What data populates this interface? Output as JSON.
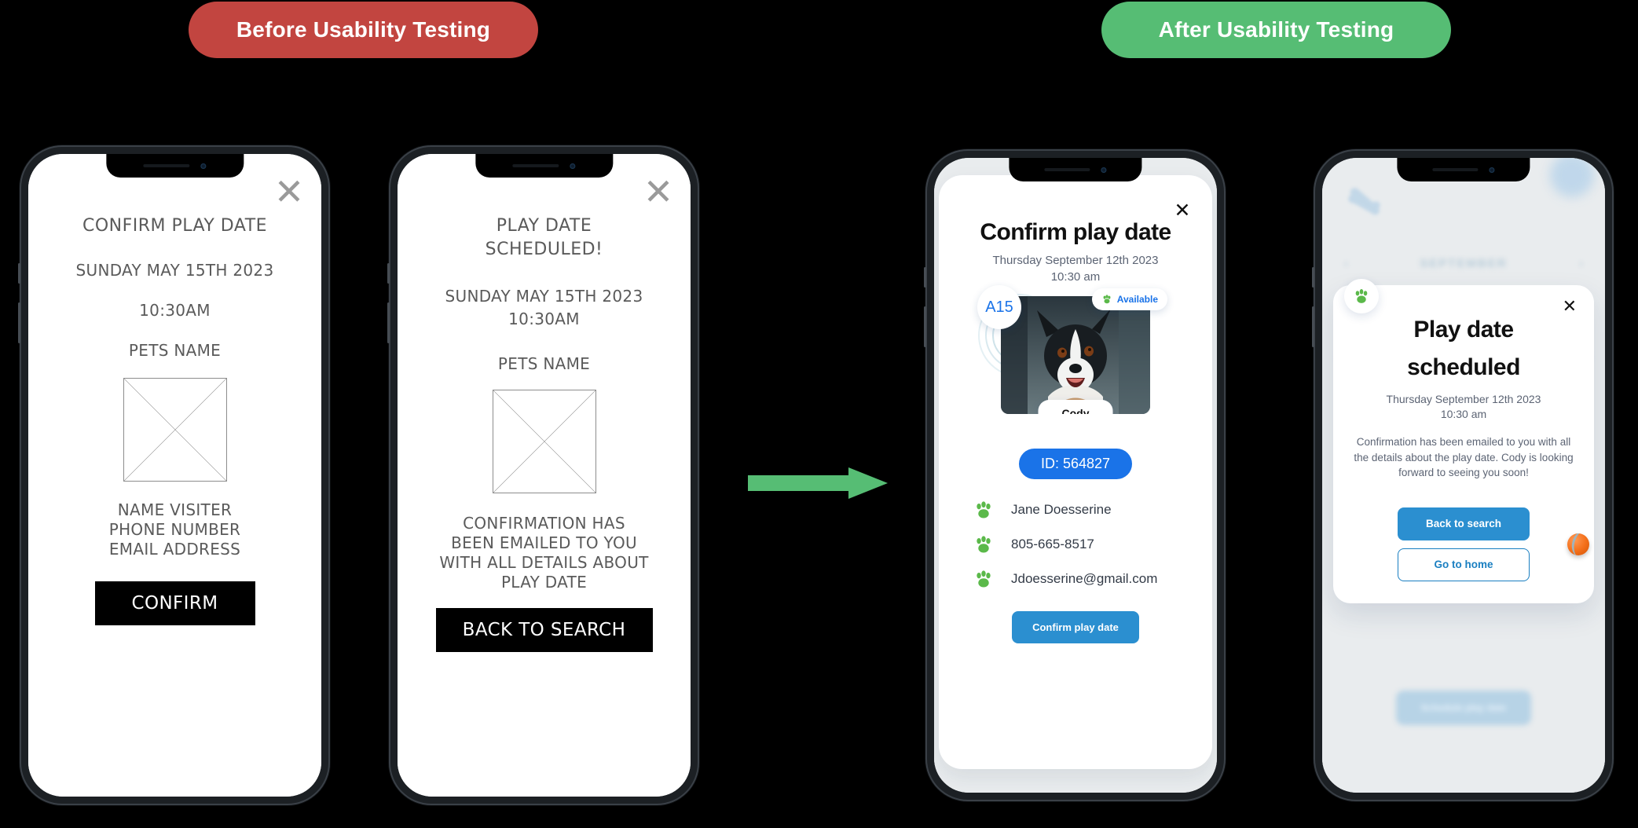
{
  "labels": {
    "before_badge": "Before Usability Testing",
    "after_badge": "After Usability Testing",
    "arrow": "transition-arrow"
  },
  "colors": {
    "before_pill": "#c24540",
    "after_pill": "#56bd74",
    "arrow": "#56bd74",
    "accent_blue": "#1a73e8",
    "button_blue": "#2b8fd0",
    "paw_green": "#5bb94a",
    "background": "#000000"
  },
  "before": {
    "screen1": {
      "close_icon": "close-icon",
      "title": "CONFIRM PLAY DATE",
      "date": "SUNDAY MAY 15TH 2023",
      "time": "10:30AM",
      "pet_label": "PETS NAME",
      "image_placeholder": "image-placeholder",
      "fields": [
        "NAME VISITER",
        "PHONE NUMBER",
        "EMAIL ADDRESS"
      ],
      "button": "CONFIRM"
    },
    "screen2": {
      "close_icon": "close-icon",
      "title_line1": "PLAY DATE",
      "title_line2": "SCHEDULED!",
      "date": "SUNDAY MAY 15TH 2023",
      "time": "10:30AM",
      "pet_label": "PETS NAME",
      "image_placeholder": "image-placeholder",
      "message": [
        "CONFIRMATION HAS",
        "BEEN EMAILED TO YOU",
        "WITH ALL DETAILS ABOUT",
        "PLAY DATE"
      ],
      "button": "BACK TO SEARCH"
    }
  },
  "after": {
    "screen3": {
      "close_icon": "close-icon",
      "title": "Confirm play date",
      "date": "Thursday September 12th 2023",
      "time": "10:30 am",
      "kennel_badge": "A15",
      "status_badge": "Available",
      "pet_name": "Cody",
      "id_pill": "ID: 564827",
      "contacts": [
        {
          "icon": "paw-icon",
          "text": "Jane Doesserine"
        },
        {
          "icon": "paw-icon",
          "text": "805-665-8517"
        },
        {
          "icon": "paw-icon",
          "text": "Jdoesserine@gmail.com"
        }
      ],
      "button": "Confirm play date"
    },
    "screen4": {
      "background": {
        "month": "SEPTEMBER",
        "prev_chevron": "‹",
        "next_chevron": "›",
        "bottom_button": "Schedule play date",
        "bone_icon": "bone-icon"
      },
      "modal": {
        "paw_icon": "paw-icon",
        "close_icon": "close-icon",
        "title_line1": "Play date",
        "title_line2": "scheduled",
        "date": "Thursday September 12th 2023",
        "time": "10:30 am",
        "body": "Confirmation has been emailed to you with all the details about the play date. Cody is looking forward to seeing you soon!",
        "primary_button": "Back to search",
        "secondary_button": "Go to home",
        "ball_icon": "tennis-ball-icon"
      }
    }
  }
}
